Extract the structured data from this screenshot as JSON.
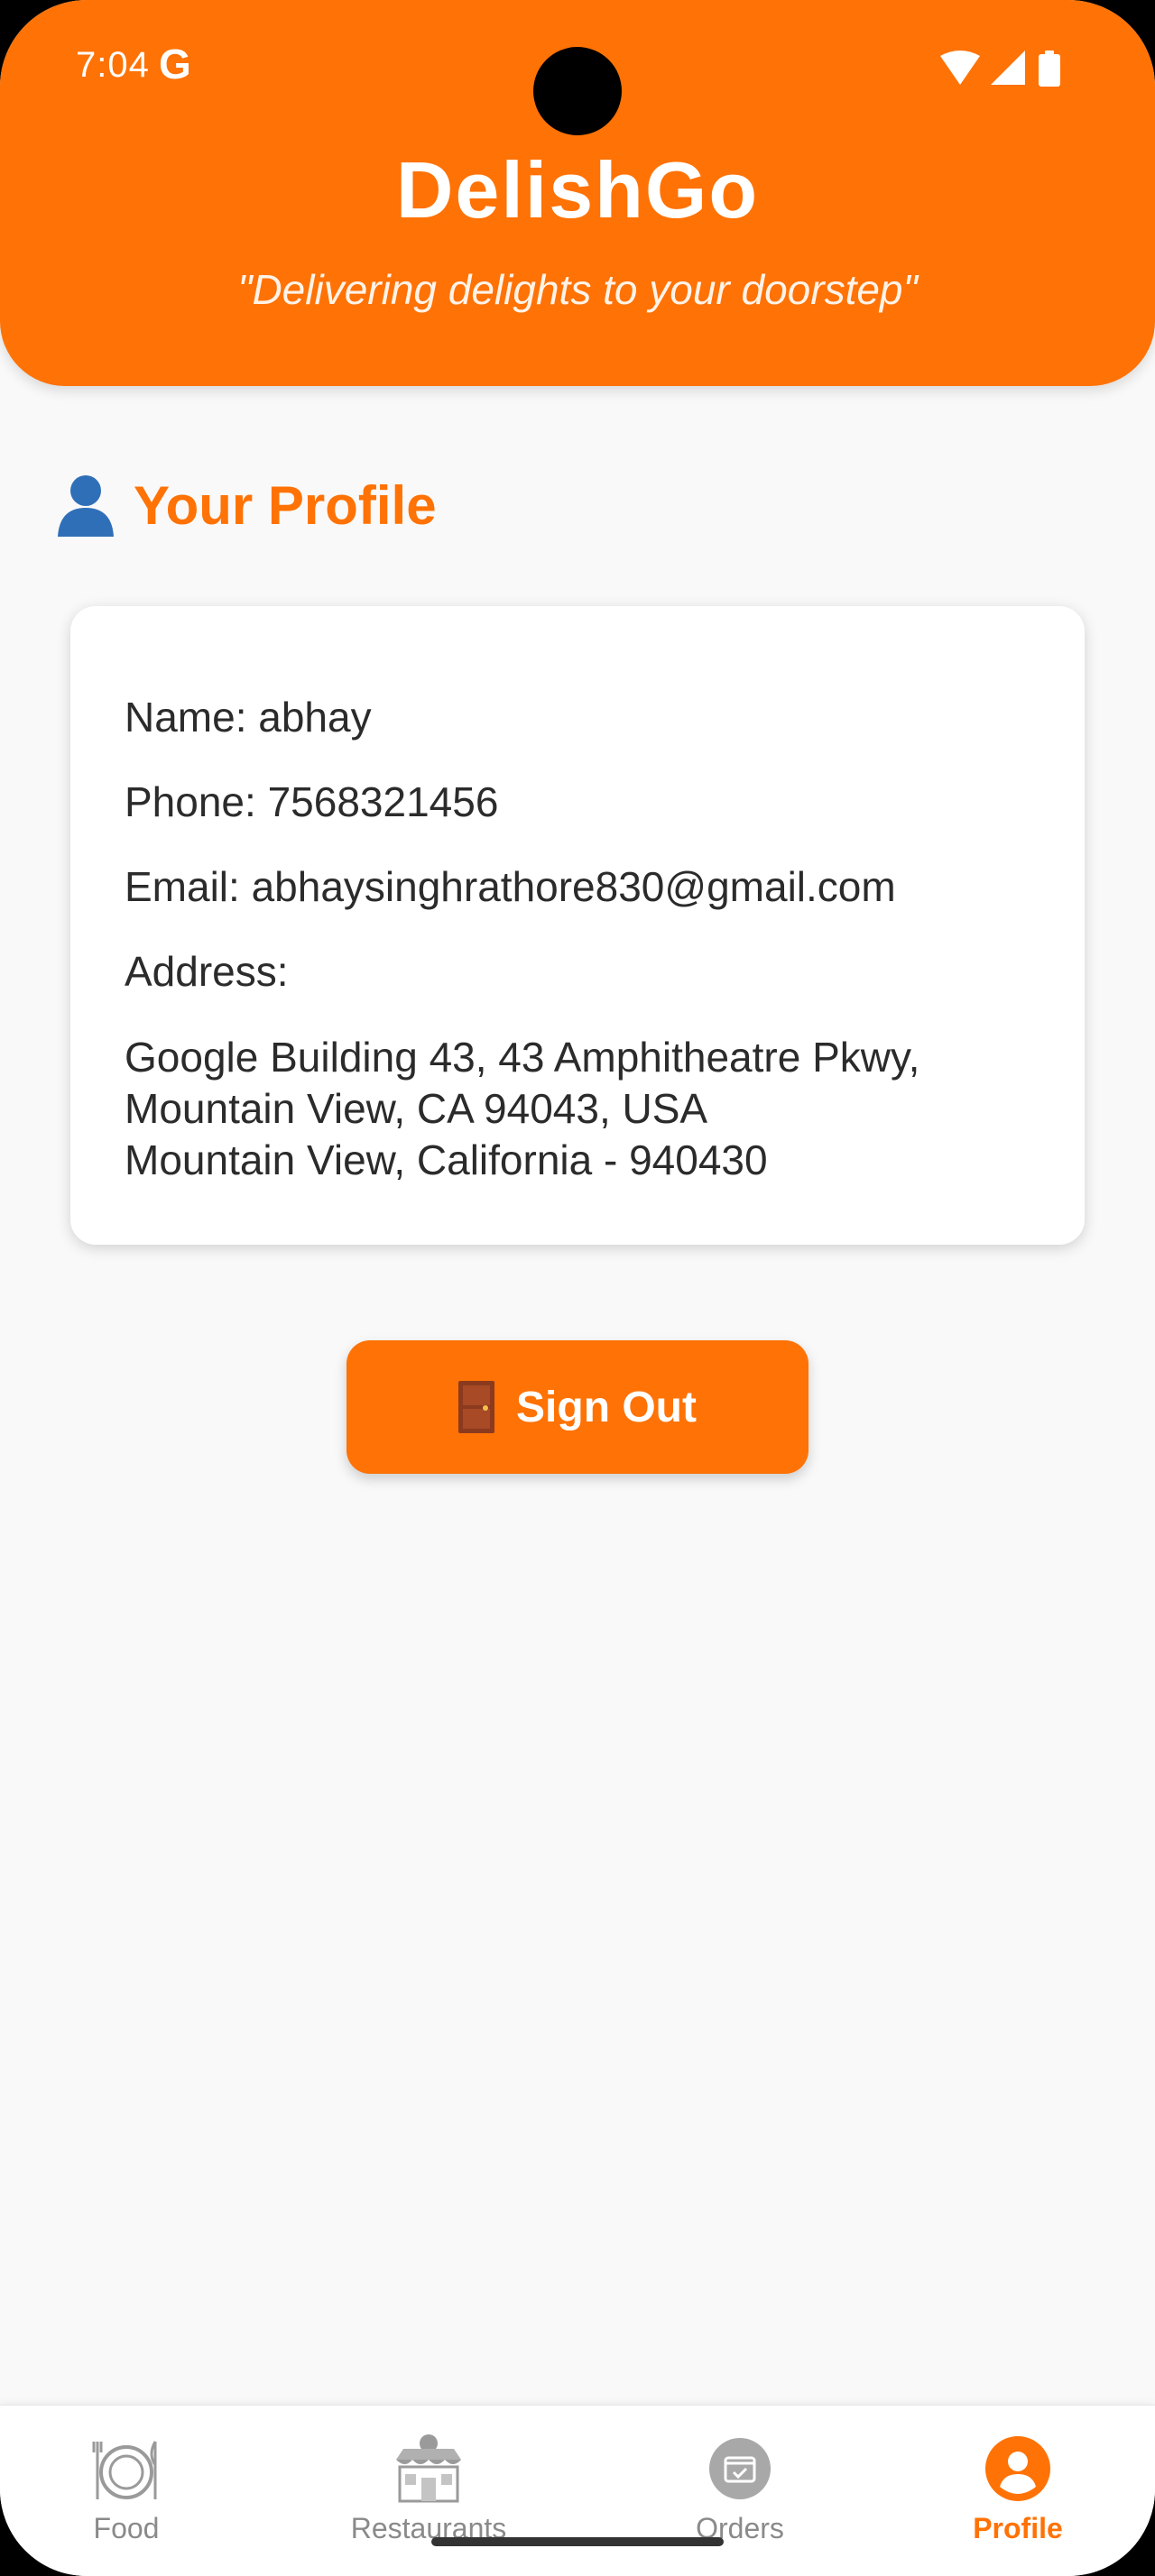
{
  "status_bar": {
    "time": "7:04",
    "g_logo": "G",
    "icons": [
      "wifi-icon",
      "signal-icon",
      "battery-icon"
    ]
  },
  "header": {
    "title": "DelishGo",
    "tagline": "\"Delivering delights to your doorstep\""
  },
  "section": {
    "title": "Your Profile",
    "icon": "person-icon"
  },
  "profile": {
    "name": "Name: abhay",
    "phone": "Phone: 7568321456",
    "email": "Email: abhaysinghrathore830@gmail.com",
    "address_label": "Address:",
    "address_lines": [
      "Google Building 43, 43 Amphitheatre Pkwy,",
      "Mountain View, CA 94043, USA",
      "Mountain View, California - 940430"
    ]
  },
  "signout": {
    "label": "Sign Out",
    "icon": "door-icon"
  },
  "nav": {
    "items": [
      {
        "label": "Food",
        "icon": "food-plate-icon",
        "active": false
      },
      {
        "label": "Restaurants",
        "icon": "storefront-icon",
        "active": false
      },
      {
        "label": "Orders",
        "icon": "orders-box-icon",
        "active": false
      },
      {
        "label": "Profile",
        "icon": "profile-icon",
        "active": true
      }
    ]
  },
  "colors": {
    "accent": "#ff7205",
    "background": "#f9f9f9",
    "text": "#2b2b2b",
    "nav_inactive": "#8a8a8a"
  }
}
